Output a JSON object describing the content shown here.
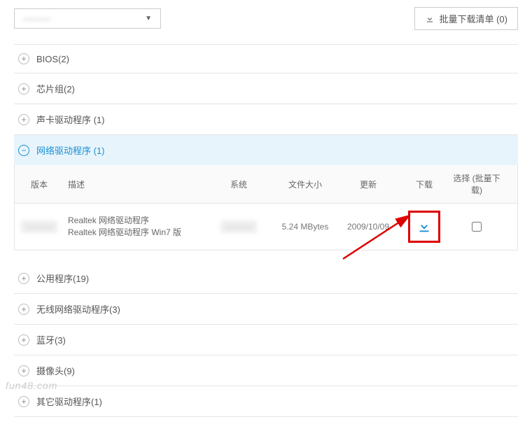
{
  "top": {
    "dropdown_value": "———",
    "batch_button": "批量下载清单 (0)"
  },
  "categories": [
    {
      "label": "BIOS(2)",
      "expanded": false
    },
    {
      "label": "芯片组(2)",
      "expanded": false
    },
    {
      "label": "声卡驱动程序 (1)",
      "expanded": false
    },
    {
      "label": "网络驱动程序 (1)",
      "expanded": true
    },
    {
      "label": "公用程序(19)",
      "expanded": false
    },
    {
      "label": "无线网络驱动程序(3)",
      "expanded": false
    },
    {
      "label": "蓝牙(3)",
      "expanded": false
    },
    {
      "label": "摄像头(9)",
      "expanded": false
    },
    {
      "label": "其它驱动程序(1)",
      "expanded": false
    }
  ],
  "table": {
    "headers": {
      "version": "版本",
      "desc": "描述",
      "system": "系统",
      "size": "文件大小",
      "updated": "更新",
      "download": "下载",
      "select": "选择 (批量下载)"
    },
    "rows": [
      {
        "version": "———",
        "desc_line1": "Realtek 网络驱动程序",
        "desc_line2": "Realtek 网络驱动程序 Win7 版",
        "system": "———",
        "size": "5.24 MBytes",
        "updated": "2009/10/09"
      }
    ]
  },
  "watermark": "fun48.com"
}
